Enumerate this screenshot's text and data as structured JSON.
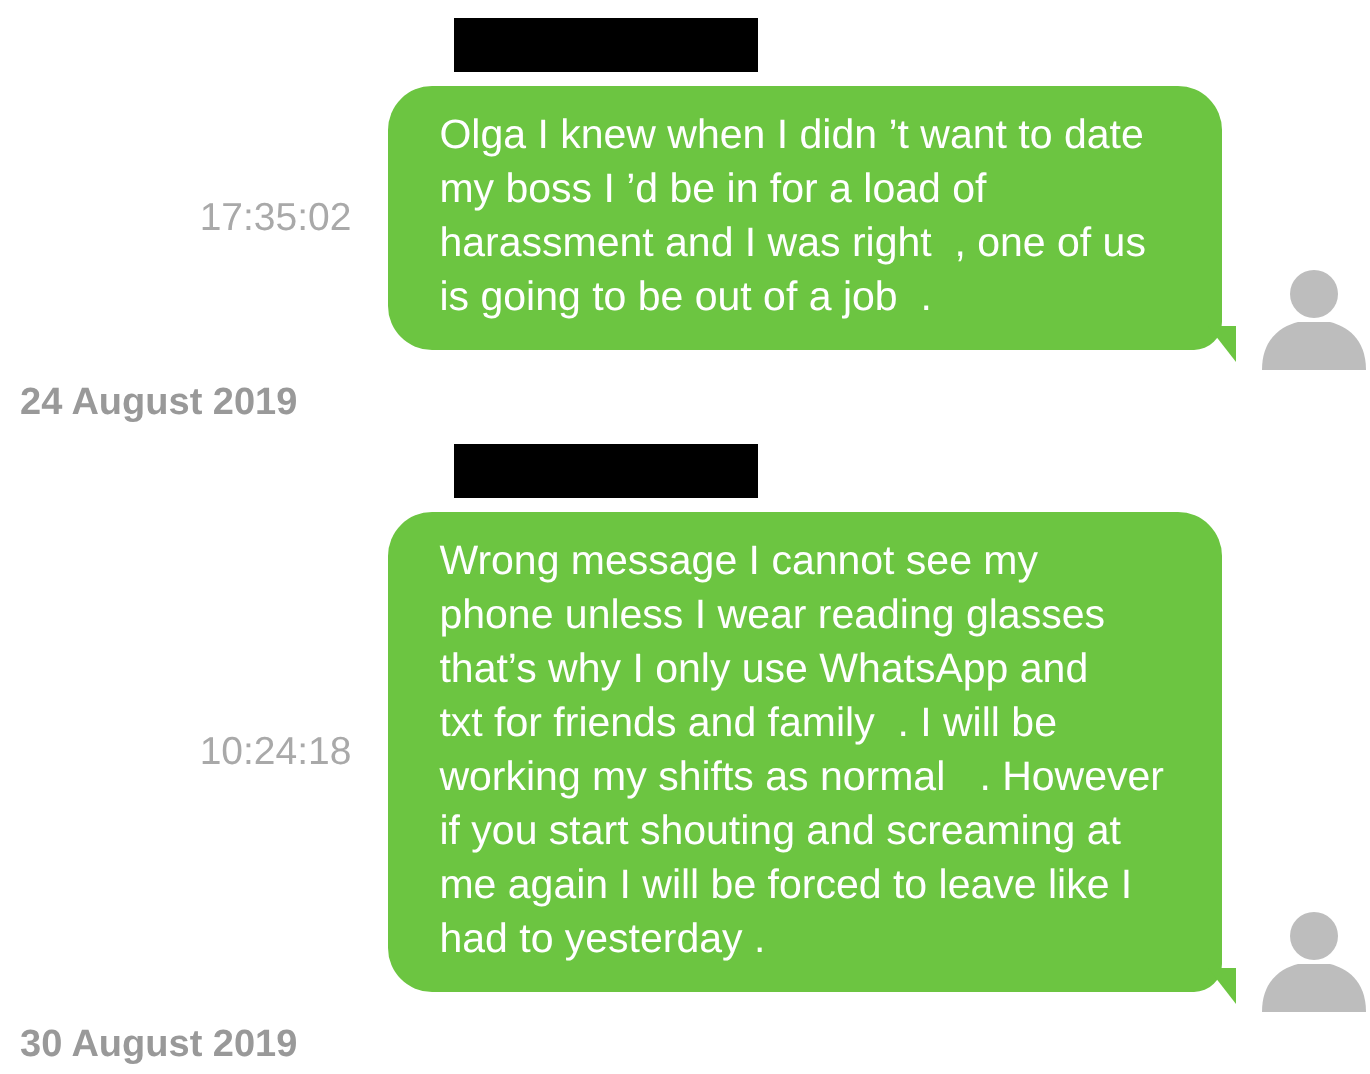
{
  "messages": [
    {
      "redacted": true,
      "time": "17:35:02",
      "lines": [
        "Olga I knew when I didn ’t want to date",
        "my boss I ’d be in for a load of",
        "harassment and I was right  , one of us",
        "is going to be out of a job  ."
      ],
      "date_after": "24 August 2019"
    },
    {
      "redacted": true,
      "time": "10:24:18",
      "lines": [
        "Wrong message I cannot see my",
        "phone unless I wear reading glasses",
        "that’s why I only use WhatsApp and",
        "txt for friends and family  . I will be",
        "working my shifts as normal   . However",
        "if you start shouting and screaming at",
        "me again I will be forced to leave like I",
        "had to yesterday ."
      ],
      "date_after": "30 August 2019"
    }
  ]
}
